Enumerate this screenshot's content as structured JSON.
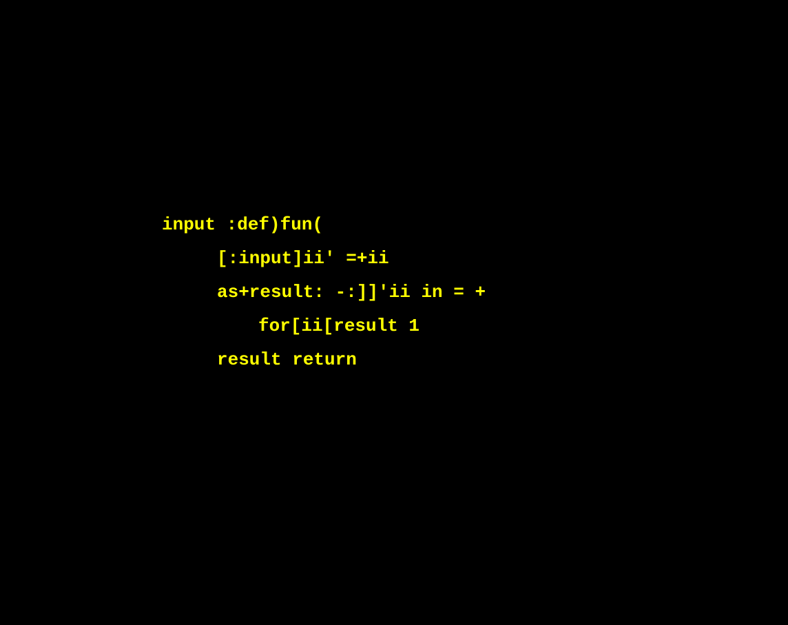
{
  "code": {
    "lines": [
      "input :def)fun(",
      "[:input]ii' =+ii",
      "as+result: -:]]'ii in = +",
      "for[ii[result 1",
      "result return"
    ]
  },
  "colors": {
    "background": "#000000",
    "text": "#FFFF00"
  }
}
